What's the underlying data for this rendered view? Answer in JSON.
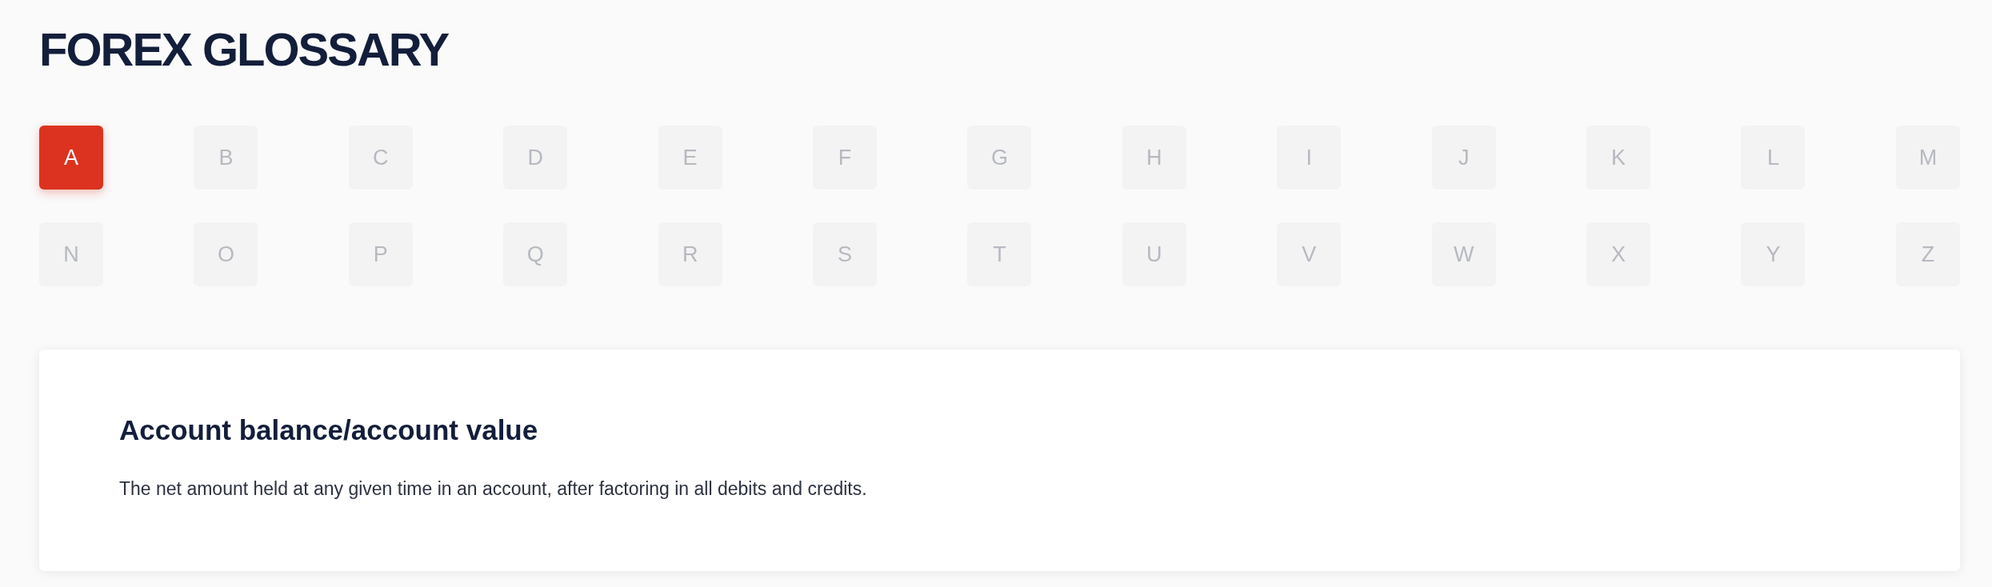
{
  "page": {
    "title": "FOREX GLOSSARY"
  },
  "letters": [
    {
      "label": "A",
      "selected": true
    },
    {
      "label": "B",
      "selected": false
    },
    {
      "label": "C",
      "selected": false
    },
    {
      "label": "D",
      "selected": false
    },
    {
      "label": "E",
      "selected": false
    },
    {
      "label": "F",
      "selected": false
    },
    {
      "label": "G",
      "selected": false
    },
    {
      "label": "H",
      "selected": false
    },
    {
      "label": "I",
      "selected": false
    },
    {
      "label": "J",
      "selected": false
    },
    {
      "label": "K",
      "selected": false
    },
    {
      "label": "L",
      "selected": false
    },
    {
      "label": "M",
      "selected": false
    },
    {
      "label": "N",
      "selected": false
    },
    {
      "label": "O",
      "selected": false
    },
    {
      "label": "P",
      "selected": false
    },
    {
      "label": "Q",
      "selected": false
    },
    {
      "label": "R",
      "selected": false
    },
    {
      "label": "S",
      "selected": false
    },
    {
      "label": "T",
      "selected": false
    },
    {
      "label": "U",
      "selected": false
    },
    {
      "label": "V",
      "selected": false
    },
    {
      "label": "W",
      "selected": false
    },
    {
      "label": "X",
      "selected": false
    },
    {
      "label": "Y",
      "selected": false
    },
    {
      "label": "Z",
      "selected": false
    }
  ],
  "entry": {
    "term": "Account balance/account value",
    "definition": "The net amount held at any given time in an account, after factoring in all debits and credits."
  }
}
